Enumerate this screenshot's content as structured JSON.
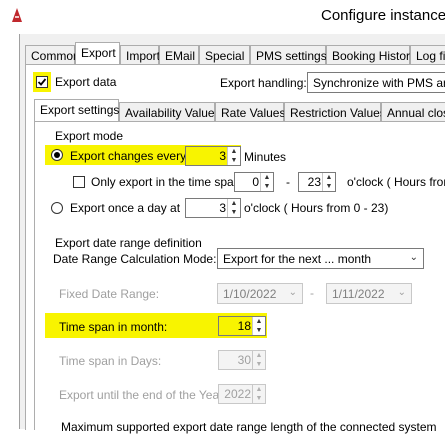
{
  "window": {
    "title": "Configure instance"
  },
  "main_tabs": [
    {
      "label": "Common"
    },
    {
      "label": "Export"
    },
    {
      "label": "Import"
    },
    {
      "label": "EMail"
    },
    {
      "label": "Special"
    },
    {
      "label": "PMS settings"
    },
    {
      "label": "Booking History"
    },
    {
      "label": "Log fil"
    }
  ],
  "export_data": {
    "label": "Export data",
    "checked": true
  },
  "export_handling": {
    "label": "Export handling:",
    "value": "Synchronize with PMS and e"
  },
  "sub_tabs": [
    {
      "label": "Export settings"
    },
    {
      "label": "Availability Values"
    },
    {
      "label": "Rate Values"
    },
    {
      "label": "Restriction Values"
    },
    {
      "label": "Annual closi"
    }
  ],
  "export_mode": {
    "heading": "Export mode",
    "changes_every": {
      "label": "Export changes every",
      "value": "3",
      "unit": "Minutes",
      "selected": true
    },
    "time_span": {
      "label": "Only export in the time span",
      "from": "0",
      "dash": "-",
      "to": "23",
      "unit": "o'clock ( Hours from"
    },
    "once_a_day": {
      "label": "Export once a day at",
      "value": "3",
      "unit": "o'clock ( Hours from 0 - 23)"
    }
  },
  "date_range": {
    "heading": "Export date range definition",
    "calc_mode": {
      "label": "Date Range Calculation Mode:",
      "value": "Export for the next ... month"
    },
    "fixed": {
      "label": "Fixed Date Range:",
      "from": "1/10/2022",
      "dash": "-",
      "to": "1/11/2022"
    },
    "span_month": {
      "label": "Time span in month:",
      "value": "18"
    },
    "span_days": {
      "label": "Time span in Days:",
      "value": "30"
    },
    "until_year": {
      "label": "Export until the end of the Year:",
      "value": "2022"
    },
    "max_supported": {
      "label": "Maximum supported export date range length of the  connected system"
    }
  }
}
